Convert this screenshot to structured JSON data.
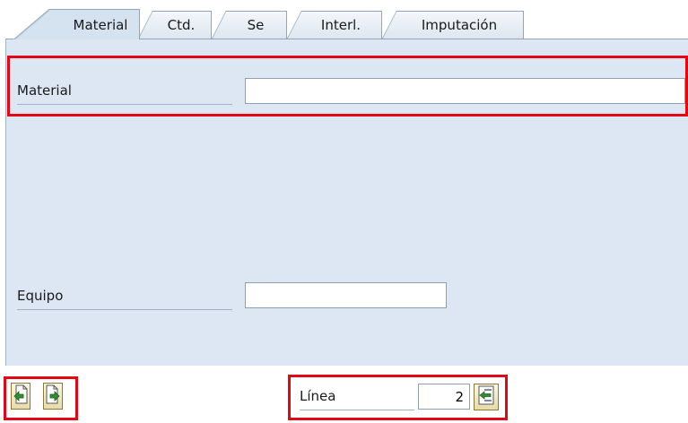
{
  "tabs": [
    {
      "label": "Material",
      "active": true
    },
    {
      "label": "Ctd.",
      "active": false
    },
    {
      "label": "Se",
      "active": false
    },
    {
      "label": "Interl.",
      "active": false
    },
    {
      "label": "Imputación",
      "active": false
    }
  ],
  "form": {
    "material_label": "Material",
    "material_value": "",
    "equipo_label": "Equipo",
    "equipo_value": ""
  },
  "footer": {
    "linea_label": "Línea",
    "linea_value": "2",
    "prev_icon": "previous-item-icon",
    "next_icon": "next-item-icon",
    "goto_icon": "goto-line-icon"
  },
  "colors": {
    "panel_bg": "#dde7f3",
    "highlight": "#e30613",
    "tab_border": "#8fa6bd",
    "button_bg": "#e8dca9",
    "button_icon_green": "#2f8f2f"
  }
}
